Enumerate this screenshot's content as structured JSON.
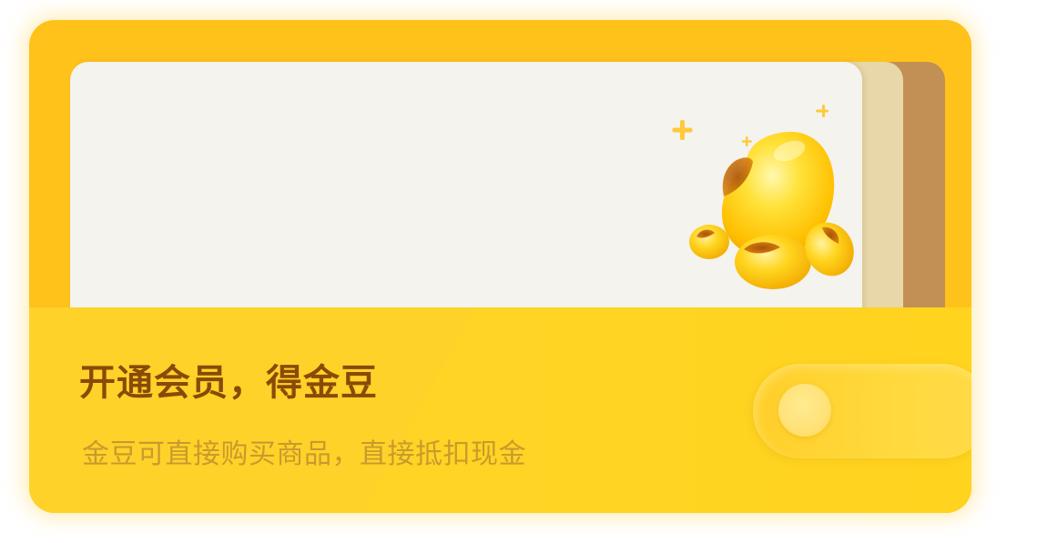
{
  "promo": {
    "title": "开通会员，得金豆",
    "subtitle": "金豆可直接购买商品，直接抵扣现金"
  },
  "colors": {
    "wallet": "#ffc21a",
    "pocket": "#ffd52b",
    "card_front": "#f4f3ee",
    "card_mid": "#e8d7a9",
    "card_back": "#c28f54",
    "title_text": "#8a4a06",
    "subtitle_text": "#c99a2c"
  },
  "icons": {
    "illustration": "golden-beans-icon",
    "sparkles": "sparkle-icon",
    "clasp": "wallet-clasp-button"
  }
}
